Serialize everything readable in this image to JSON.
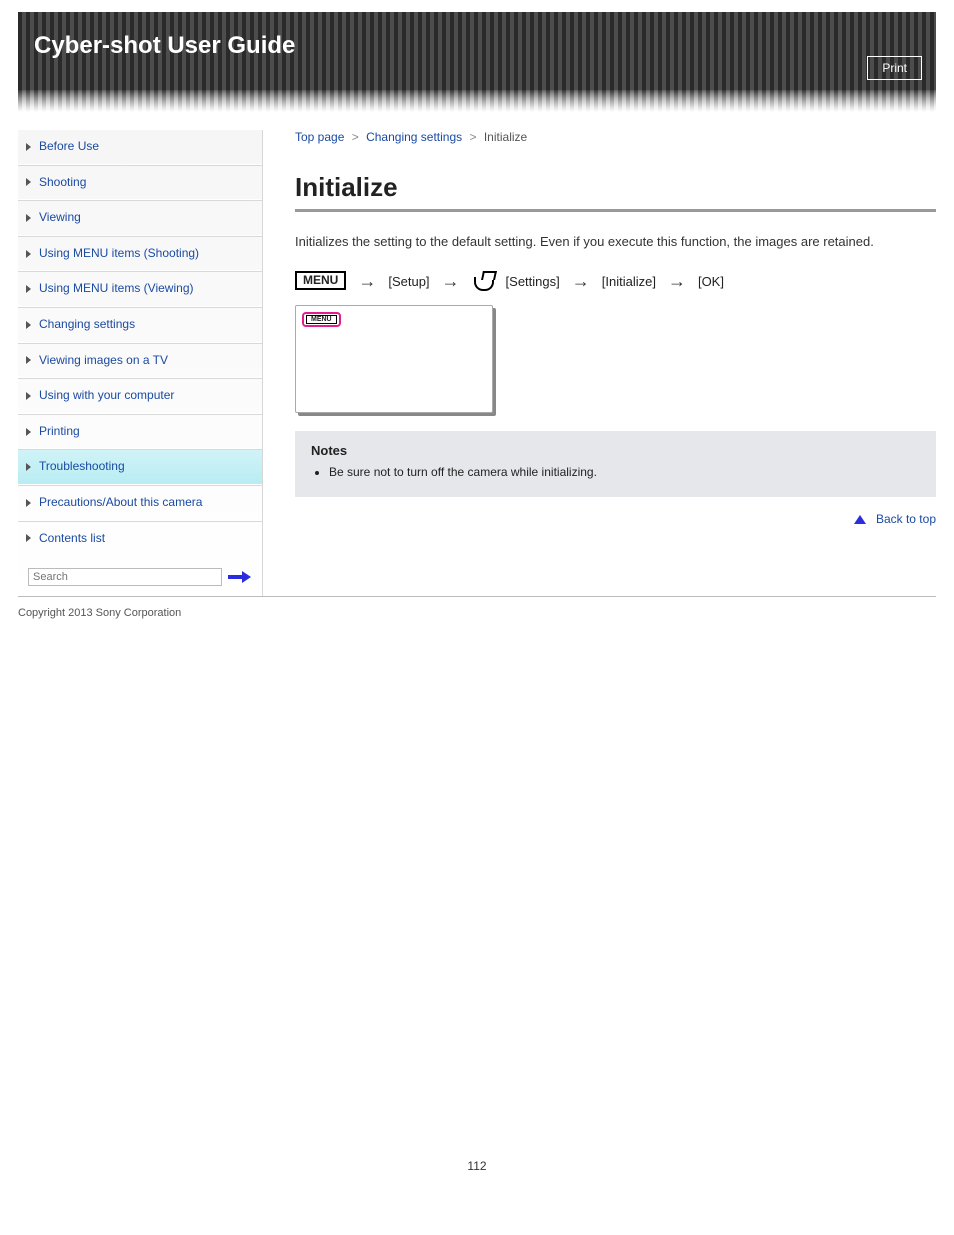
{
  "header": {
    "title": "Cyber-shot User Guide",
    "subtitle": "",
    "print_label": "Print"
  },
  "sidebar": {
    "items": [
      {
        "label": "Before Use",
        "active": false
      },
      {
        "label": "Shooting",
        "active": false
      },
      {
        "label": "Viewing",
        "active": false
      },
      {
        "label": "Using MENU items (Shooting)",
        "active": false
      },
      {
        "label": "Using MENU items (Viewing)",
        "active": false
      },
      {
        "label": "Changing settings",
        "active": false
      },
      {
        "label": "Viewing images on a TV",
        "active": false
      },
      {
        "label": "Using with your computer",
        "active": false
      },
      {
        "label": "Printing",
        "active": false
      },
      {
        "label": "Troubleshooting",
        "active": true
      },
      {
        "label": "Precautions/About this camera",
        "active": false
      },
      {
        "label": "Contents list",
        "active": false
      }
    ],
    "search_placeholder": "Search"
  },
  "breadcrumb": {
    "items": [
      {
        "label": "Top page",
        "link": true
      },
      {
        "label": "Changing settings",
        "link": true
      },
      {
        "label": "Initialize",
        "link": false
      }
    ],
    "sep": ">"
  },
  "main": {
    "h1": "Initialize",
    "lead": "Initializes the setting to the default setting. Even if you execute this function, the images are retained.",
    "menu_label": "MENU",
    "path_step1": "[Setup]",
    "path_icon_name": "settings-icon",
    "path_step2_prefix": "[Settings]",
    "path_step2": "[Initialize]",
    "path_step3": "[OK]",
    "notes_title": "Notes",
    "notes_items": [
      "Be sure not to turn off the camera while initializing."
    ],
    "back_to_top": "Back to top"
  },
  "footer": {
    "copyright": "Copyright 2013 Sony Corporation",
    "page_number": "112"
  }
}
